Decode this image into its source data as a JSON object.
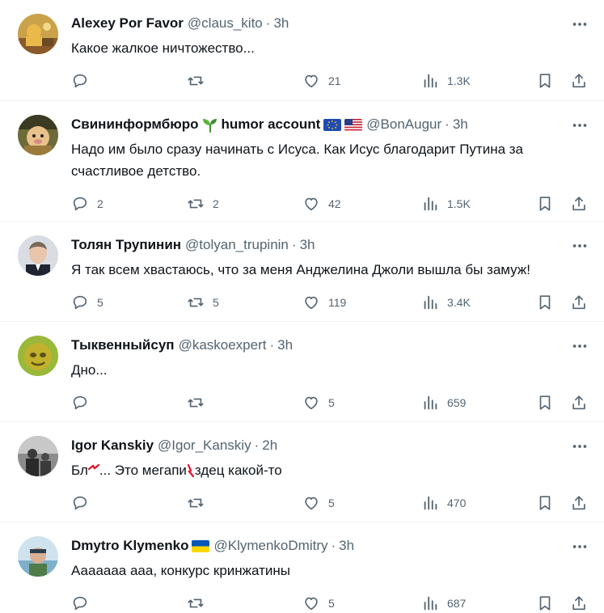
{
  "tweets": [
    {
      "name": "Alexey Por Favor",
      "handle": "@claus_kito",
      "dot": "·",
      "time": "3h",
      "text": "Какое жалкое ничтожество...",
      "reply_count": "",
      "retweet_count": "",
      "like_count": "21",
      "view_count": "1.3K"
    },
    {
      "name": "Свининформбюро",
      "name_suffix": "humor account",
      "handle": "@BonAugur",
      "dot": "·",
      "time": "3h",
      "text": "Надо им было сразу начинать с Исуса. Как Исус благодарит Путина за счастливое детство.",
      "reply_count": "2",
      "retweet_count": "2",
      "like_count": "42",
      "view_count": "1.5K"
    },
    {
      "name": "Толян Трупинин",
      "handle": "@tolyan_trupinin",
      "dot": "·",
      "time": "3h",
      "text": "Я так всем хвастаюсь, что за меня Анджелина Джоли вышла бы замуж!",
      "reply_count": "5",
      "retweet_count": "5",
      "like_count": "119",
      "view_count": "3.4K"
    },
    {
      "name": "Тыквенныйсуп",
      "handle": "@kaskoexpert",
      "dot": "·",
      "time": "3h",
      "text": "Дно...",
      "reply_count": "",
      "retweet_count": "",
      "like_count": "5",
      "view_count": "659"
    },
    {
      "name": "Igor Kanskiy",
      "handle": "@Igor_Kanskiy",
      "dot": "·",
      "time": "2h",
      "text_part1": "Бл",
      "text_part2": "... Это мегапи",
      "text_part3": "здец какой-то",
      "reply_count": "",
      "retweet_count": "",
      "like_count": "5",
      "view_count": "470"
    },
    {
      "name": "Dmytro Klymenko",
      "handle": "@KlymenkoDmitry",
      "dot": "·",
      "time": "3h",
      "text": "Ааааааа ааа, конкурс кринжатины",
      "reply_count": "",
      "retweet_count": "",
      "like_count": "5",
      "view_count": "687"
    }
  ]
}
